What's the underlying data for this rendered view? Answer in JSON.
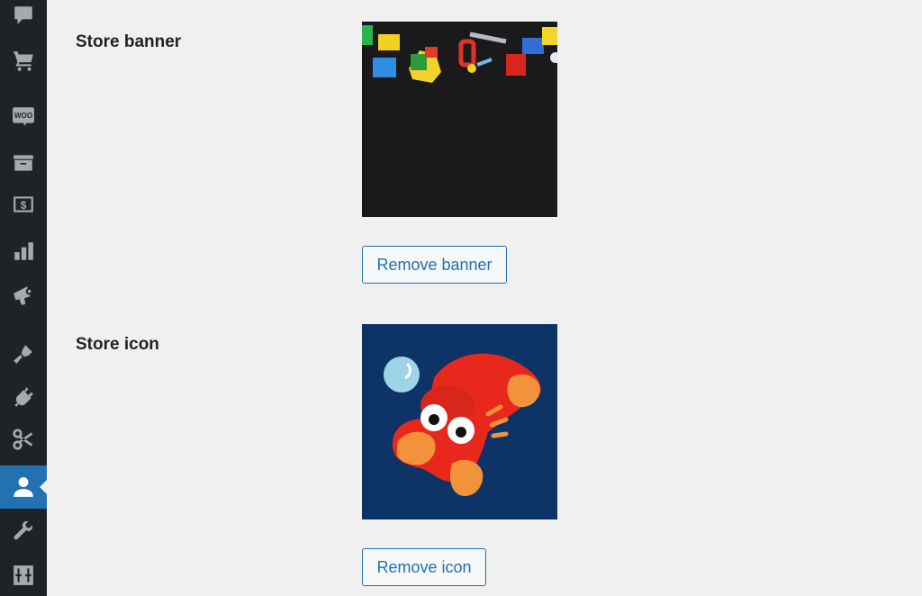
{
  "sidebar": {
    "items": [
      {
        "name": "comments",
        "icon": "comment-bubble-icon",
        "active": false
      },
      {
        "name": "shop",
        "icon": "shopping-cart-icon",
        "active": false
      },
      {
        "name": "woocommerce",
        "icon": "woo-icon",
        "active": false
      },
      {
        "name": "products",
        "icon": "archive-box-icon",
        "active": false
      },
      {
        "name": "payments",
        "icon": "dollar-icon",
        "active": false
      },
      {
        "name": "analytics",
        "icon": "bar-chart-icon",
        "active": false
      },
      {
        "name": "marketing",
        "icon": "megaphone-icon",
        "active": false
      },
      {
        "name": "appearance",
        "icon": "paintbrush-icon",
        "active": false
      },
      {
        "name": "plugins",
        "icon": "plugin-icon",
        "active": false
      },
      {
        "name": "tools-snippets",
        "icon": "scissors-icon",
        "active": false
      },
      {
        "name": "users",
        "icon": "user-icon",
        "active": true
      },
      {
        "name": "tools",
        "icon": "wrench-icon",
        "active": false
      },
      {
        "name": "settings",
        "icon": "sliders-icon",
        "active": false
      }
    ],
    "woo_text": "WOO",
    "dollar_text": "$"
  },
  "settings": {
    "banner": {
      "label": "Store banner",
      "image_alt": "Colorful toy building blocks on a black background",
      "remove_label": "Remove banner"
    },
    "icon": {
      "label": "Store icon",
      "image_alt": "Red clay lobster on a navy blue background",
      "remove_label": "Remove icon"
    }
  },
  "colors": {
    "sidebar_bg": "#1d2327",
    "active_bg": "#2271b1",
    "page_bg": "#f0f0f1",
    "button_text": "#2271b1"
  }
}
